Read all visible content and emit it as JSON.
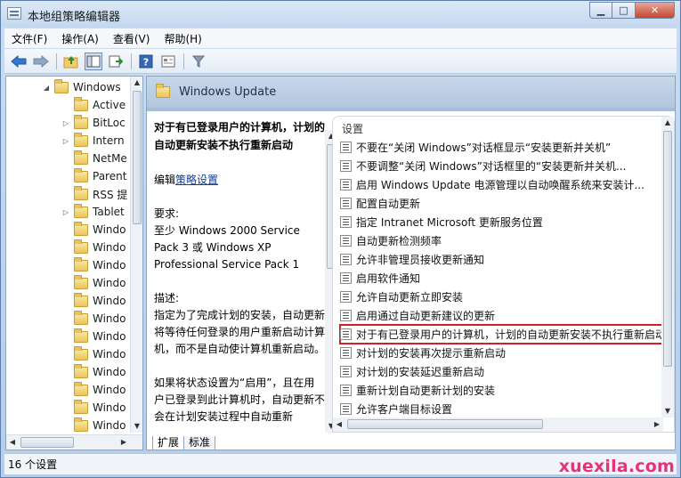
{
  "window": {
    "title": "本地组策略编辑器"
  },
  "caption": {
    "minimize": "▁",
    "maximize": "□",
    "close": "✕"
  },
  "menu": [
    "文件(F)",
    "操作(A)",
    "查看(V)",
    "帮助(H)"
  ],
  "toolbar": {
    "icons": [
      "back-arrow-icon",
      "forward-arrow-icon",
      "up-folder-icon",
      "show-hide-tree-icon",
      "export-list-icon",
      "help-icon",
      "details-view-icon",
      "filter-icon"
    ]
  },
  "tree": {
    "items": [
      {
        "label": "Windows",
        "expander": "◢"
      },
      {
        "label": "Active",
        "expander": ""
      },
      {
        "label": "BitLoc",
        "expander": "▷"
      },
      {
        "label": "Intern",
        "expander": "▷"
      },
      {
        "label": "NetMe",
        "expander": ""
      },
      {
        "label": "Parent",
        "expander": ""
      },
      {
        "label": "RSS 提",
        "expander": ""
      },
      {
        "label": "Tablet",
        "expander": "▷"
      },
      {
        "label": "Windo",
        "expander": ""
      },
      {
        "label": "Windo",
        "expander": ""
      },
      {
        "label": "Windo",
        "expander": ""
      },
      {
        "label": "Windo",
        "expander": ""
      },
      {
        "label": "Windo",
        "expander": ""
      },
      {
        "label": "Windo",
        "expander": ""
      },
      {
        "label": "Windo",
        "expander": ""
      },
      {
        "label": "Windo",
        "expander": ""
      },
      {
        "label": "Windo",
        "expander": ""
      },
      {
        "label": "Windo",
        "expander": ""
      },
      {
        "label": "Windo",
        "expander": ""
      },
      {
        "label": "Windo",
        "expander": ""
      }
    ]
  },
  "right": {
    "header_title": "Windows Update",
    "desc": {
      "title": "对于有已登录用户的计算机，计划的自动更新安装不执行重新启动",
      "edit_prefix": "编辑",
      "edit_link": "策略设置",
      "req_label": "要求:",
      "req_text": "至少 Windows 2000 Service Pack 3 或 Windows XP Professional Service Pack 1",
      "desc_label": "描述:",
      "desc_text": "指定为了完成计划的安装，自动更新将等待任何登录的用户重新启动计算机，而不是自动使计算机重新启动。",
      "extra_text": "如果将状态设置为“启用”，且在用户已登录到此计算机时，自动更新不会在计划安装过程中自动重新"
    },
    "settings_header": "设置",
    "settings": [
      "不要在“关闭 Windows”对话框显示“安装更新并关机”",
      "不要调整“关闭 Windows”对话框里的“安装更新并关机...",
      "启用 Windows Update 电源管理以自动唤醒系统来安装计...",
      "配置自动更新",
      "指定 Intranet Microsoft 更新服务位置",
      "自动更新检测频率",
      "允许非管理员接收更新通知",
      "启用软件通知",
      "允许自动更新立即安装",
      "启用通过自动更新建议的更新",
      "对于有已登录用户的计算机，计划的自动更新安装不执行重新启动",
      "对计划的安装再次提示重新启动",
      "对计划的安装延迟重新启动",
      "重新计划自动更新计划的安装",
      "允许客户端目标设置"
    ],
    "selected_index": 10,
    "tabs": [
      "扩展",
      "标准"
    ],
    "active_tab": 0
  },
  "status": {
    "text": "16 个设置"
  },
  "watermark": "xuexila.com",
  "colors": {
    "selection_outline": "#d0202a",
    "watermark": "#e7327a",
    "link": "#0b3fa3"
  }
}
